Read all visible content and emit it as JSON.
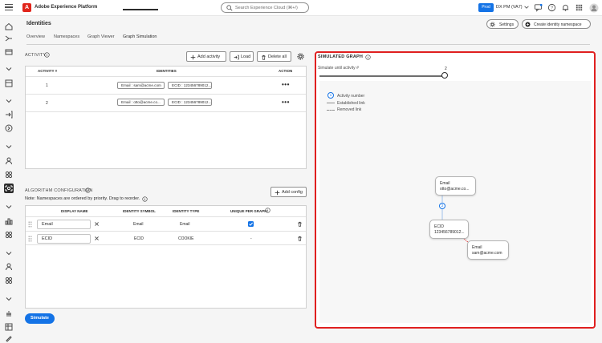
{
  "app": {
    "title": "Adobe Experience Platform",
    "logo_letter": "A"
  },
  "search": {
    "placeholder": "Search Experience Cloud (⌘+/)"
  },
  "topbar": {
    "env_badge": "Prod",
    "org_name": "DX PM (VA7)"
  },
  "page": {
    "title": "Identities"
  },
  "header_buttons": {
    "settings": "Settings",
    "create": "Create identity namespace"
  },
  "tabs": [
    {
      "label": "Overview"
    },
    {
      "label": "Namespaces"
    },
    {
      "label": "Graph Viewer"
    },
    {
      "label": "Graph Simulation",
      "selected": true
    }
  ],
  "activity": {
    "section_label": "ACTIVITY",
    "add_label": "Add activity",
    "load_label": "Load",
    "delete_label": "Delete all",
    "columns": [
      "ACTIVITY #",
      "IDENTITIES",
      "ACTION"
    ],
    "rows": [
      {
        "number": "1",
        "identities": [
          "Email : sam@acme.com",
          "ECID : 123456789012..."
        ],
        "action": "•••"
      },
      {
        "number": "2",
        "identities": [
          "Email : otto@acme.co...",
          "ECID : 123456789012..."
        ],
        "action": "•••"
      }
    ]
  },
  "algorithm": {
    "section_label": "ALGORITHM CONFIGURATION",
    "note": "Note: Namespaces are ordered by priority. Drag to reorder.",
    "add_label": "Add config",
    "columns": [
      "DISPLAY NAME",
      "IDENTITY SYMBOL",
      "IDENTITY TYPE",
      "UNIQUE PER GRAPH"
    ],
    "rows": [
      {
        "display_name": "Email",
        "symbol": "Email",
        "type": "Email",
        "unique": "checked"
      },
      {
        "display_name": "ECID",
        "symbol": "ECID",
        "type": "COOKIE",
        "unique": "-"
      }
    ]
  },
  "simulate_label": "Simulate",
  "graph": {
    "title": "SIMULATED GRAPH",
    "slider_label": "Simulate until activity #",
    "slider_value": "2",
    "slider_fraction": 1.0,
    "legend": {
      "activity_num": "1",
      "activity": "Activity number",
      "established": "Established link",
      "removed": "Removed link"
    },
    "nodes": [
      {
        "type": "Email",
        "value": "otto@acme.co..."
      },
      {
        "type": "ECID",
        "value": "123456789012..."
      },
      {
        "type": "Email",
        "value": "sam@acme.com"
      }
    ],
    "edge_label": "2"
  },
  "colors": {
    "accent": "#1473e6",
    "highlight": "#e02020",
    "logo": "#e1251b"
  }
}
